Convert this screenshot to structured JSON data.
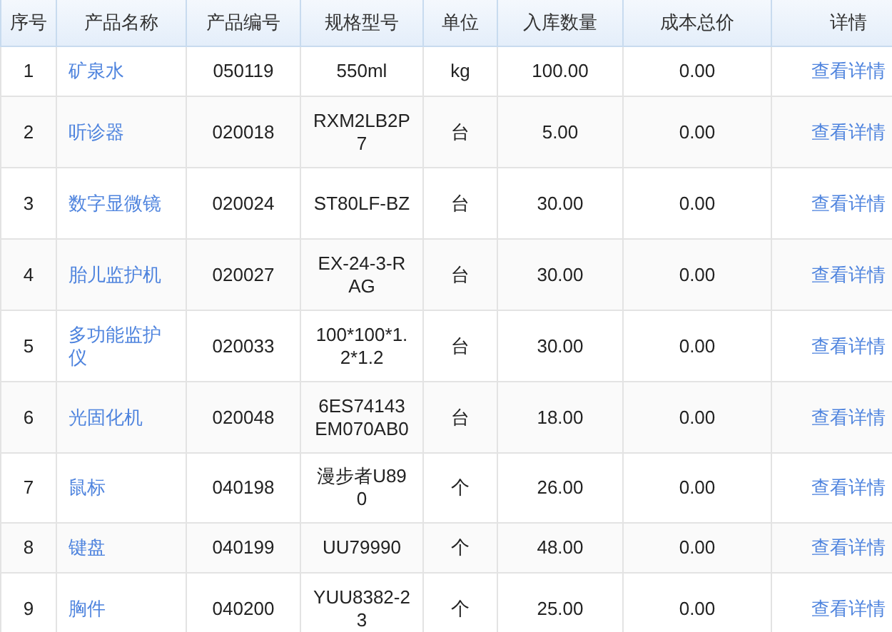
{
  "table": {
    "columns": [
      "序号",
      "产品名称",
      "产品编号",
      "规格型号",
      "单位",
      "入库数量",
      "成本总价",
      "详情"
    ],
    "rows": [
      {
        "index": "1",
        "name": "矿泉水",
        "code": "050119",
        "spec": "550ml",
        "unit": "kg",
        "quantity": "100.00",
        "cost": "0.00",
        "detail": "查看详情"
      },
      {
        "index": "2",
        "name": "听诊器",
        "code": "020018",
        "spec": "RXM2LB2P7",
        "unit": "台",
        "quantity": "5.00",
        "cost": "0.00",
        "detail": "查看详情"
      },
      {
        "index": "3",
        "name": "数字显微镜",
        "code": "020024",
        "spec": "ST80LF-BZ",
        "unit": "台",
        "quantity": "30.00",
        "cost": "0.00",
        "detail": "查看详情"
      },
      {
        "index": "4",
        "name": "胎儿监护机",
        "code": "020027",
        "spec": "EX-24-3-RAG",
        "unit": "台",
        "quantity": "30.00",
        "cost": "0.00",
        "detail": "查看详情"
      },
      {
        "index": "5",
        "name": "多功能监护仪",
        "code": "020033",
        "spec": "100*100*1.2*1.2",
        "unit": "台",
        "quantity": "30.00",
        "cost": "0.00",
        "detail": "查看详情"
      },
      {
        "index": "6",
        "name": "光固化机",
        "code": "020048",
        "spec": "6ES74143EM070AB0",
        "unit": "台",
        "quantity": "18.00",
        "cost": "0.00",
        "detail": "查看详情"
      },
      {
        "index": "7",
        "name": "鼠标",
        "code": "040198",
        "spec": "漫步者U890",
        "unit": "个",
        "quantity": "26.00",
        "cost": "0.00",
        "detail": "查看详情"
      },
      {
        "index": "8",
        "name": "键盘",
        "code": "040199",
        "spec": "UU79990",
        "unit": "个",
        "quantity": "48.00",
        "cost": "0.00",
        "detail": "查看详情"
      },
      {
        "index": "9",
        "name": "胸件",
        "code": "040200",
        "spec": "YUU8382-23",
        "unit": "个",
        "quantity": "25.00",
        "cost": "0.00",
        "detail": "查看详情"
      }
    ]
  }
}
